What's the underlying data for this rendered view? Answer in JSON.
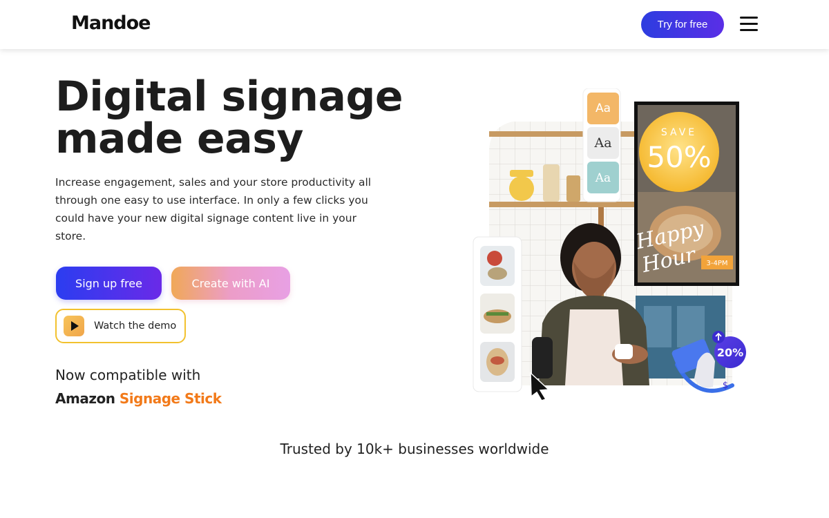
{
  "header": {
    "logo": "Mandoe",
    "try_label": "Try for free",
    "menu_icon": "hamburger-menu-icon"
  },
  "hero": {
    "title_line1": "Digital signage",
    "title_line2": "made easy",
    "description": "Increase engagement, sales and your store productivity all through one easy to use interface. In only a few clicks you could have your new digital signage content live in your store.",
    "signup_label": "Sign up free",
    "ai_label": "Create with AI",
    "demo_label": "Watch the demo",
    "compat_label": "Now compatible with",
    "amazon_word": "Amazon",
    "signage_word": "Signage Stick"
  },
  "illustration": {
    "font_sample": "Aa",
    "save_label": "SAVE",
    "save_value": "50%",
    "promo_line1": "Happy",
    "promo_line2": "Hour",
    "time_tag": "3-4PM",
    "discount_badge": "20%",
    "currency_symbol": "$"
  },
  "trusted_text": "Trusted by 10k+ businesses worldwide",
  "colors": {
    "primary": "#2d3de0",
    "accent_orange": "#f27a1a",
    "demo_border": "#f2c12e"
  }
}
